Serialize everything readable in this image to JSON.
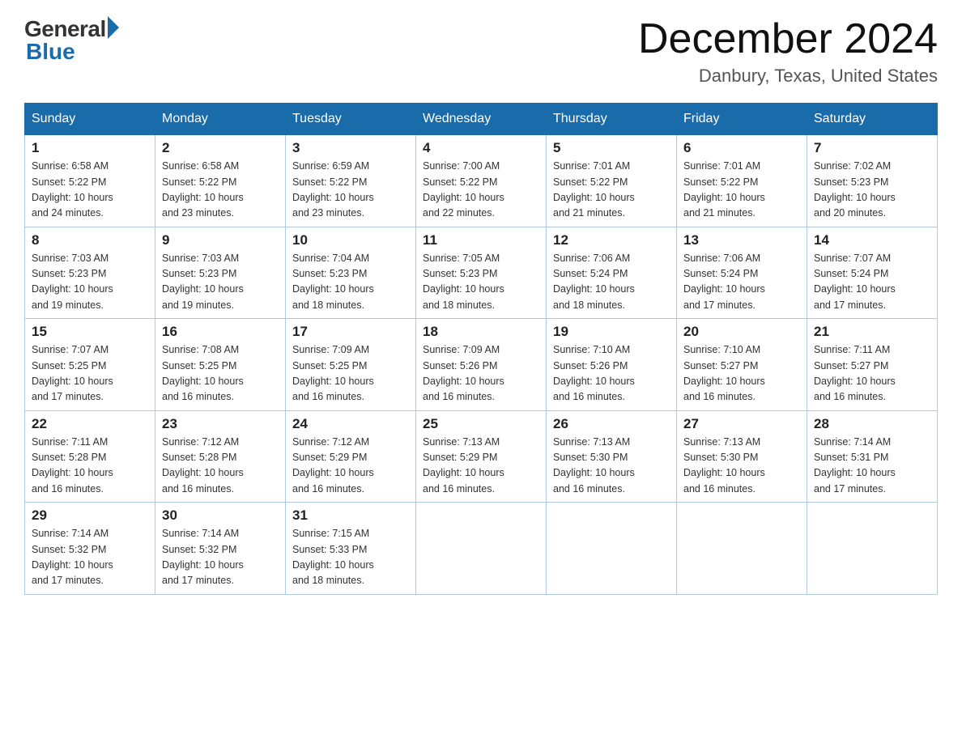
{
  "logo": {
    "general": "General",
    "blue": "Blue"
  },
  "title": {
    "month_year": "December 2024",
    "location": "Danbury, Texas, United States"
  },
  "headers": [
    "Sunday",
    "Monday",
    "Tuesday",
    "Wednesday",
    "Thursday",
    "Friday",
    "Saturday"
  ],
  "weeks": [
    [
      {
        "day": "1",
        "sunrise": "6:58 AM",
        "sunset": "5:22 PM",
        "daylight": "10 hours and 24 minutes."
      },
      {
        "day": "2",
        "sunrise": "6:58 AM",
        "sunset": "5:22 PM",
        "daylight": "10 hours and 23 minutes."
      },
      {
        "day": "3",
        "sunrise": "6:59 AM",
        "sunset": "5:22 PM",
        "daylight": "10 hours and 23 minutes."
      },
      {
        "day": "4",
        "sunrise": "7:00 AM",
        "sunset": "5:22 PM",
        "daylight": "10 hours and 22 minutes."
      },
      {
        "day": "5",
        "sunrise": "7:01 AM",
        "sunset": "5:22 PM",
        "daylight": "10 hours and 21 minutes."
      },
      {
        "day": "6",
        "sunrise": "7:01 AM",
        "sunset": "5:22 PM",
        "daylight": "10 hours and 21 minutes."
      },
      {
        "day": "7",
        "sunrise": "7:02 AM",
        "sunset": "5:23 PM",
        "daylight": "10 hours and 20 minutes."
      }
    ],
    [
      {
        "day": "8",
        "sunrise": "7:03 AM",
        "sunset": "5:23 PM",
        "daylight": "10 hours and 19 minutes."
      },
      {
        "day": "9",
        "sunrise": "7:03 AM",
        "sunset": "5:23 PM",
        "daylight": "10 hours and 19 minutes."
      },
      {
        "day": "10",
        "sunrise": "7:04 AM",
        "sunset": "5:23 PM",
        "daylight": "10 hours and 18 minutes."
      },
      {
        "day": "11",
        "sunrise": "7:05 AM",
        "sunset": "5:23 PM",
        "daylight": "10 hours and 18 minutes."
      },
      {
        "day": "12",
        "sunrise": "7:06 AM",
        "sunset": "5:24 PM",
        "daylight": "10 hours and 18 minutes."
      },
      {
        "day": "13",
        "sunrise": "7:06 AM",
        "sunset": "5:24 PM",
        "daylight": "10 hours and 17 minutes."
      },
      {
        "day": "14",
        "sunrise": "7:07 AM",
        "sunset": "5:24 PM",
        "daylight": "10 hours and 17 minutes."
      }
    ],
    [
      {
        "day": "15",
        "sunrise": "7:07 AM",
        "sunset": "5:25 PM",
        "daylight": "10 hours and 17 minutes."
      },
      {
        "day": "16",
        "sunrise": "7:08 AM",
        "sunset": "5:25 PM",
        "daylight": "10 hours and 16 minutes."
      },
      {
        "day": "17",
        "sunrise": "7:09 AM",
        "sunset": "5:25 PM",
        "daylight": "10 hours and 16 minutes."
      },
      {
        "day": "18",
        "sunrise": "7:09 AM",
        "sunset": "5:26 PM",
        "daylight": "10 hours and 16 minutes."
      },
      {
        "day": "19",
        "sunrise": "7:10 AM",
        "sunset": "5:26 PM",
        "daylight": "10 hours and 16 minutes."
      },
      {
        "day": "20",
        "sunrise": "7:10 AM",
        "sunset": "5:27 PM",
        "daylight": "10 hours and 16 minutes."
      },
      {
        "day": "21",
        "sunrise": "7:11 AM",
        "sunset": "5:27 PM",
        "daylight": "10 hours and 16 minutes."
      }
    ],
    [
      {
        "day": "22",
        "sunrise": "7:11 AM",
        "sunset": "5:28 PM",
        "daylight": "10 hours and 16 minutes."
      },
      {
        "day": "23",
        "sunrise": "7:12 AM",
        "sunset": "5:28 PM",
        "daylight": "10 hours and 16 minutes."
      },
      {
        "day": "24",
        "sunrise": "7:12 AM",
        "sunset": "5:29 PM",
        "daylight": "10 hours and 16 minutes."
      },
      {
        "day": "25",
        "sunrise": "7:13 AM",
        "sunset": "5:29 PM",
        "daylight": "10 hours and 16 minutes."
      },
      {
        "day": "26",
        "sunrise": "7:13 AM",
        "sunset": "5:30 PM",
        "daylight": "10 hours and 16 minutes."
      },
      {
        "day": "27",
        "sunrise": "7:13 AM",
        "sunset": "5:30 PM",
        "daylight": "10 hours and 16 minutes."
      },
      {
        "day": "28",
        "sunrise": "7:14 AM",
        "sunset": "5:31 PM",
        "daylight": "10 hours and 17 minutes."
      }
    ],
    [
      {
        "day": "29",
        "sunrise": "7:14 AM",
        "sunset": "5:32 PM",
        "daylight": "10 hours and 17 minutes."
      },
      {
        "day": "30",
        "sunrise": "7:14 AM",
        "sunset": "5:32 PM",
        "daylight": "10 hours and 17 minutes."
      },
      {
        "day": "31",
        "sunrise": "7:15 AM",
        "sunset": "5:33 PM",
        "daylight": "10 hours and 18 minutes."
      },
      null,
      null,
      null,
      null
    ]
  ]
}
